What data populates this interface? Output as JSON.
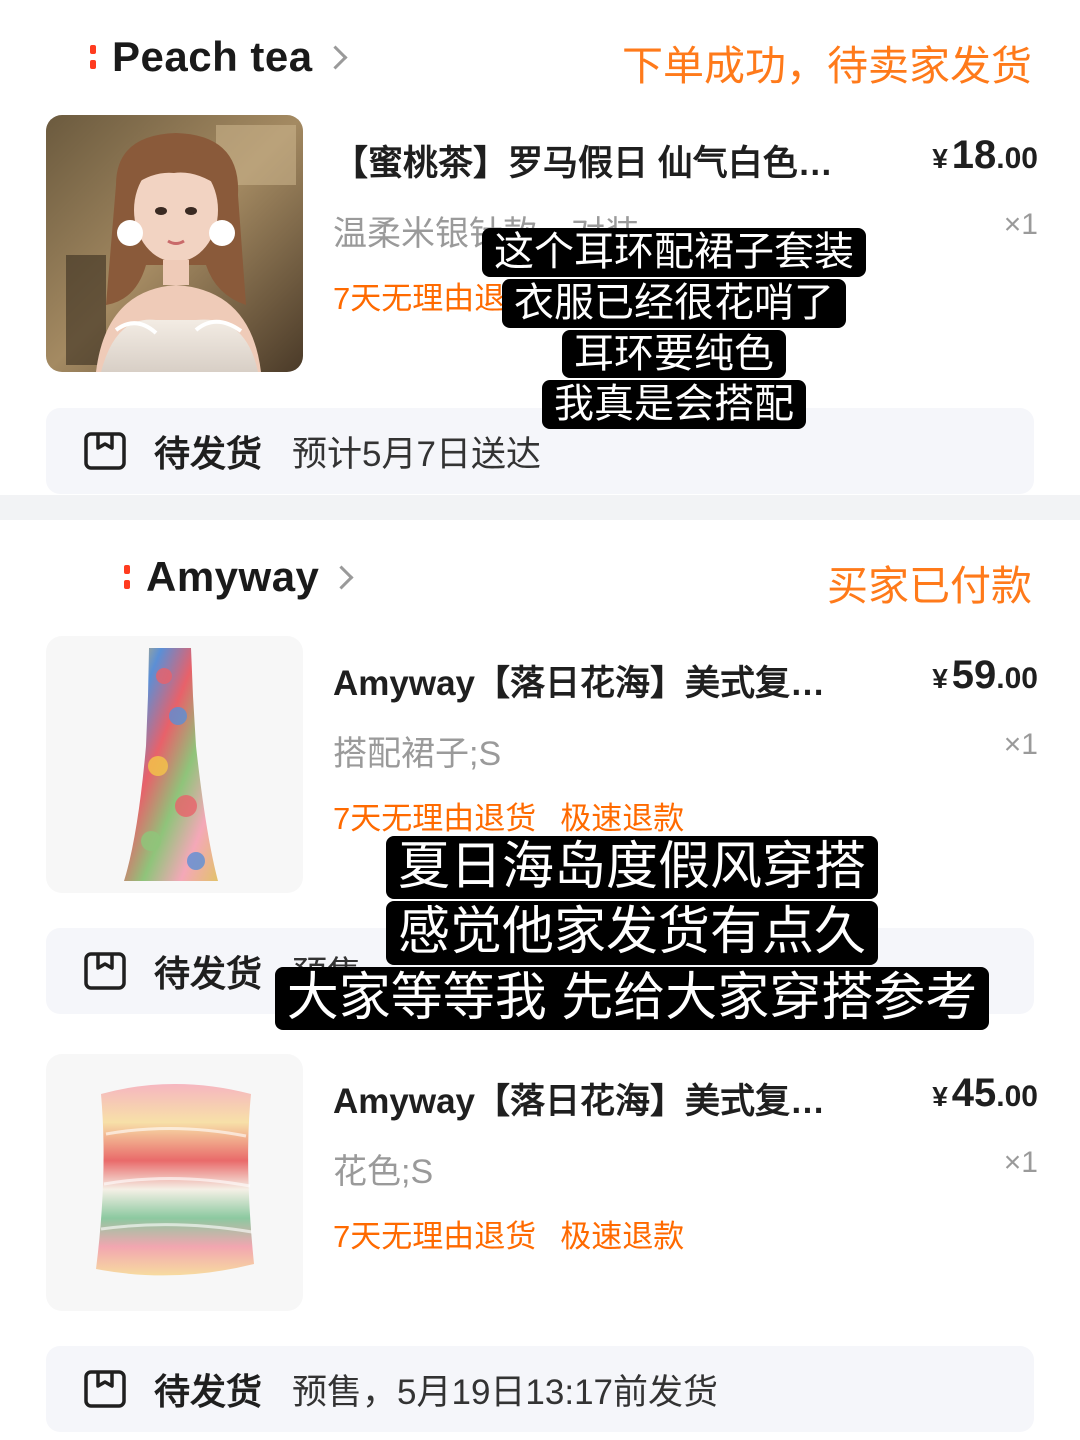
{
  "orders": [
    {
      "shop_name": "Peach tea",
      "status": "下单成功，待卖家发货",
      "items": [
        {
          "title": "【蜜桃茶】罗马假日 仙气白色…",
          "price_currency": "¥",
          "price_int": "18",
          "price_dec": ".00",
          "variant": "温柔米银针款一对装",
          "qty": "×1",
          "tags": [
            "7天无理由退货"
          ],
          "image": "portrait-photo"
        }
      ],
      "shipping": {
        "label": "待发货",
        "info": "预计5月7日送达"
      }
    },
    {
      "shop_name": "Amyway",
      "status": "买家已付款",
      "items": [
        {
          "title": "Amyway【落日花海】美式复…",
          "price_currency": "¥",
          "price_int": "59",
          "price_dec": ".00",
          "variant": "搭配裙子;S",
          "qty": "×1",
          "tags": [
            "7天无理由退货",
            "极速退款"
          ],
          "image": "floral-skirt"
        },
        {
          "title": "Amyway【落日花海】美式复…",
          "price_currency": "¥",
          "price_int": "45",
          "price_dec": ".00",
          "variant": "花色;S",
          "qty": "×1",
          "tags": [
            "7天无理由退货",
            "极速退款"
          ],
          "image": "floral-tube-top"
        }
      ],
      "shipping": [
        {
          "label": "待发货",
          "info": "预售"
        },
        {
          "label": "待发货",
          "info": "预售，5月19日13:17前发货"
        }
      ]
    }
  ],
  "captions": {
    "first": [
      "这个耳环配裙子套装",
      "衣服已经很花哨了",
      "耳环要纯色",
      "我真是会搭配"
    ],
    "second": [
      "夏日海岛度假风穿搭",
      "感觉他家发货有点久",
      "大家等等我 先给大家穿搭参考"
    ]
  },
  "colors": {
    "accent_orange": "#ff7a1a",
    "tag_orange": "#ff6a00",
    "muted_gray": "#9a9a9a",
    "bar_bg": "#f5f6fa"
  }
}
